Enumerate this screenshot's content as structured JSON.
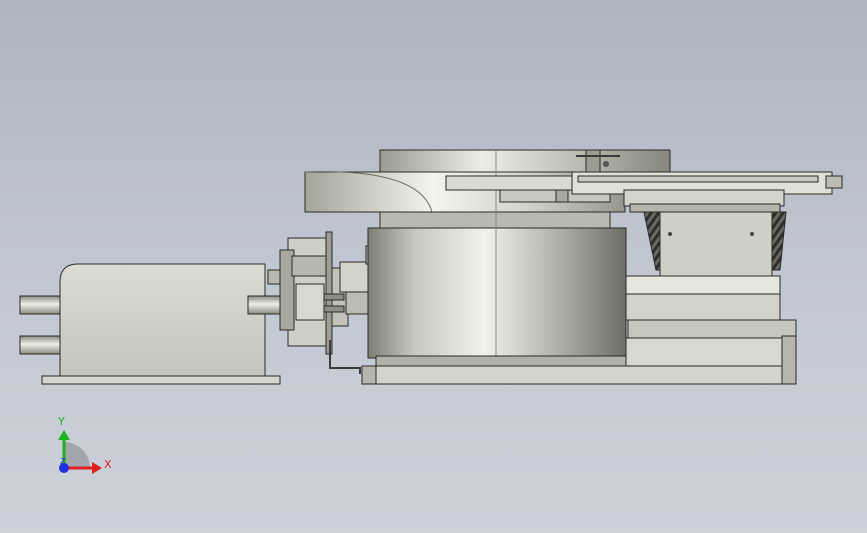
{
  "viewport": {
    "background_top": "#aeb4c0",
    "background_bottom": "#cdd1da"
  },
  "triad": {
    "x_label": "X",
    "y_label": "Y",
    "z_label": "Z",
    "x_color": "#e02020",
    "y_color": "#20b020",
    "z_color": "#2030e0"
  },
  "model": {
    "fill_light": "#e8e8e0",
    "fill_mid": "#c7c7bd",
    "fill_dark": "#8e8e84",
    "edge_color": "#2a2a2a",
    "parts": [
      "motor",
      "gearbox",
      "turntable-drum",
      "top-plate",
      "conveyor-rail",
      "base-block",
      "base-plate"
    ]
  }
}
